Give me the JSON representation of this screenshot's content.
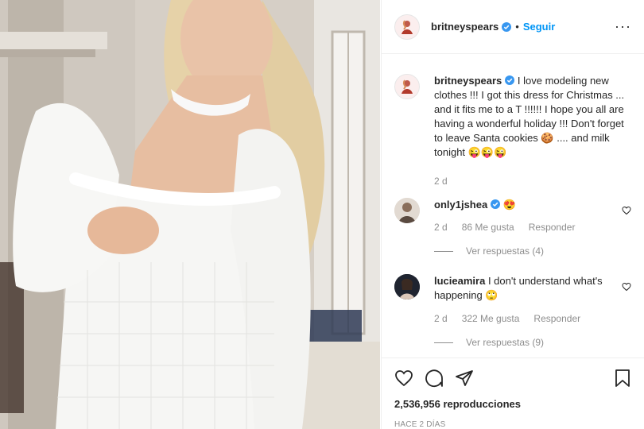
{
  "post": {
    "username": "britneyspears",
    "follow_label": "Seguir",
    "separator": "•",
    "more_label": "···",
    "accent_color": "#0095f6"
  },
  "caption": {
    "username": "britneyspears",
    "text": "I love modeling new clothes !!! I got this dress for Christmas ... and it fits me to a T !!!!!! I hope you all are having a wonderful holiday !!! Don't forget to leave Santa cookies 🍪 .... and milk tonight 😜😜😜",
    "age": "2 d"
  },
  "comments": [
    {
      "username": "only1jshea",
      "verified": true,
      "text": "😍",
      "age": "2 d",
      "likes": "86 Me gusta",
      "reply_label": "Responder",
      "view_replies": "Ver respuestas (4)"
    },
    {
      "username": "lucieamira",
      "verified": false,
      "text": "I don't understand what's happening 🙄",
      "age": "2 d",
      "likes": "322 Me gusta",
      "reply_label": "Responder",
      "view_replies": "Ver respuestas (9)"
    }
  ],
  "footer": {
    "views": "2,536,956 reproducciones",
    "posted": "HACE 2 DÍAS"
  }
}
